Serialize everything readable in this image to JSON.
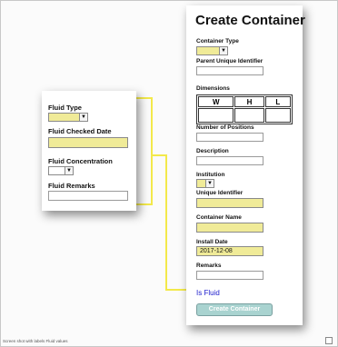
{
  "main": {
    "title": "Create Container",
    "container_type_label": "Container Type",
    "parent_uid_label": "Parent Unique Identifier",
    "dimensions_label": "Dimensions",
    "dims_headers": [
      "W",
      "H",
      "L"
    ],
    "num_positions_label": "Number of Positions",
    "description_label": "Description",
    "institution_label": "Institution",
    "unique_identifier_label": "Unique Identifier",
    "container_name_label": "Container Name",
    "install_date_label": "Install Date",
    "install_date_value": "2017-12-08",
    "remarks_label": "Remarks",
    "is_fluid_label": "Is Fluid",
    "create_button_label": "Create Container"
  },
  "fluid": {
    "fluid_type_label": "Fluid Type",
    "fluid_checked_date_label": "Fluid Checked Date",
    "fluid_concentration_label": "Fluid Concentration",
    "fluid_remarks_label": "Fluid Remarks"
  },
  "footer": {
    "status_text": "Screen shot with labels Fluid values"
  },
  "colors": {
    "required_field": "#f0eb98",
    "connector": "#f3e94a",
    "link": "#1a1acc",
    "button": "#a9d3d0"
  },
  "icons": {
    "dropdown": "chevron-down-icon"
  }
}
